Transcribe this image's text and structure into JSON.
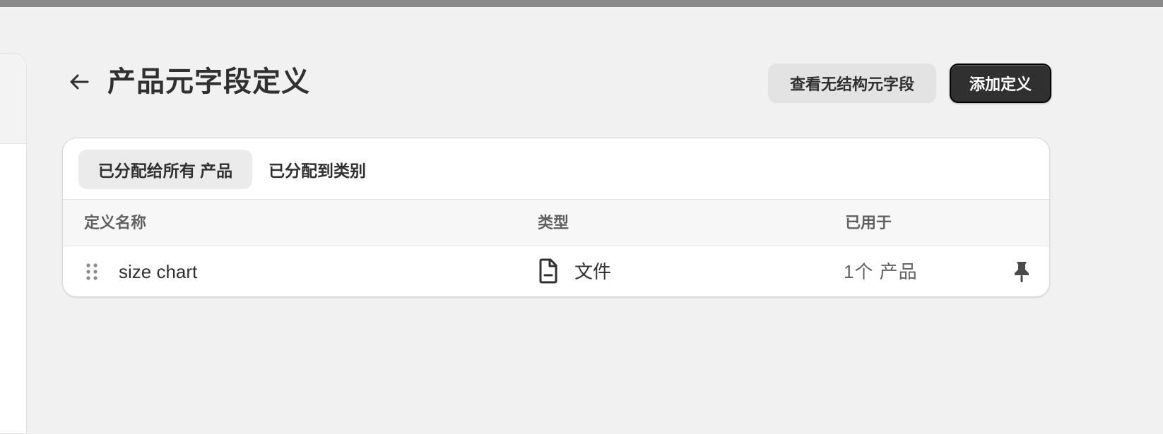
{
  "header": {
    "title": "产品元字段定义",
    "back_icon": "arrow-left-icon",
    "secondary_button_label": "查看无结构元字段",
    "primary_button_label": "添加定义"
  },
  "tabs": [
    {
      "label": "已分配给所有 产品",
      "active": true
    },
    {
      "label": "已分配到类别",
      "active": false
    }
  ],
  "table": {
    "columns": [
      "定义名称",
      "类型",
      "已用于"
    ],
    "rows": [
      {
        "name": "size chart",
        "type": "文件",
        "type_icon": "file-icon",
        "used_in": "1个 产品",
        "pinned": true,
        "pin_icon": "pin-icon",
        "drag_icon": "drag-handle-icon"
      }
    ]
  },
  "colors": {
    "background": "#f1f1f1",
    "primary_button": "#303030",
    "secondary_button": "#e3e3e3",
    "active_tab": "#ebebeb"
  }
}
